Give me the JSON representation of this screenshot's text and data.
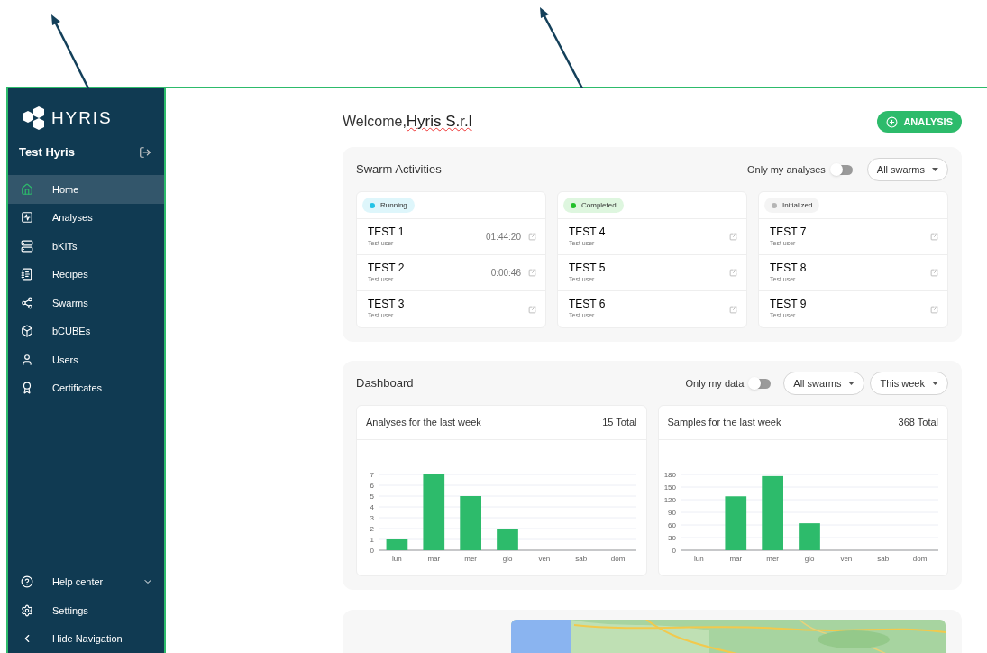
{
  "sidebar": {
    "brand": "HYRIS",
    "user": "Test Hyris",
    "items": [
      {
        "label": "Home",
        "selected": true
      },
      {
        "label": "Analyses",
        "selected": false
      },
      {
        "label": "bKITs",
        "selected": false
      },
      {
        "label": "Recipes",
        "selected": false
      },
      {
        "label": "Swarms",
        "selected": false
      },
      {
        "label": "bCUBEs",
        "selected": false
      },
      {
        "label": "Users",
        "selected": false
      },
      {
        "label": "Certificates",
        "selected": false
      }
    ],
    "footer": [
      {
        "label": "Help center",
        "expanded": false
      },
      {
        "label": "Settings"
      },
      {
        "label": "Hide Navigation"
      }
    ]
  },
  "header": {
    "greeting": "Welcome,",
    "organization": "Hyris S.r.l",
    "button": "ANALYSIS"
  },
  "swarm_activities": {
    "title": "Swarm Activities",
    "toggle": {
      "label": "Only my analyses",
      "on": false
    },
    "filter": "All swarms",
    "columns": [
      {
        "status": "Running",
        "color": "#22c3e6",
        "items": [
          {
            "name": "TEST 1",
            "user": "Test user",
            "time": "01:44:20"
          },
          {
            "name": "TEST 2",
            "user": "Test user",
            "time": "0:00:46"
          },
          {
            "name": "TEST 3",
            "user": "Test user"
          }
        ]
      },
      {
        "status": "Completed",
        "color": "#22c02a",
        "items": [
          {
            "name": "TEST 4",
            "user": "Test user"
          },
          {
            "name": "TEST 5",
            "user": "Test user"
          },
          {
            "name": "TEST 6",
            "user": "Test user"
          }
        ]
      },
      {
        "status": "Initialized",
        "color": "#b5b5b5",
        "items": [
          {
            "name": "TEST 7",
            "user": "Test user"
          },
          {
            "name": "TEST 8",
            "user": "Test user"
          },
          {
            "name": "TEST 9",
            "user": "Test user"
          }
        ]
      }
    ]
  },
  "dashboard": {
    "title": "Dashboard",
    "toggle": {
      "label": "Only my data",
      "on": false
    },
    "filters": [
      "All swarms",
      "This week"
    ],
    "charts": [
      {
        "title": "Analyses for the last week",
        "total": "15 Total",
        "chart_data": {
          "type": "bar",
          "grid": true,
          "categories": [
            "lun",
            "mar",
            "mer",
            "gio",
            "ven",
            "sab",
            "dom"
          ],
          "series": [
            {
              "color": "#2dbb6b",
              "values": [
                1,
                7,
                5,
                2,
                0,
                0,
                0
              ]
            }
          ],
          "ylim": [
            0,
            7
          ],
          "yticks": [
            0,
            1,
            2,
            3,
            4,
            5,
            6,
            7
          ]
        }
      },
      {
        "title": "Samples for the last week",
        "total": "368 Total",
        "chart_data": {
          "type": "bar",
          "grid": true,
          "categories": [
            "lun",
            "mar",
            "mer",
            "gio",
            "ven",
            "sab",
            "dom"
          ],
          "series": [
            {
              "color": "#2dbb6b",
              "values": [
                0,
                128,
                176,
                64,
                0,
                0,
                0
              ]
            }
          ],
          "ylim": [
            0,
            180
          ],
          "yticks": [
            0,
            30,
            60,
            90,
            120,
            150,
            180
          ]
        }
      }
    ]
  }
}
